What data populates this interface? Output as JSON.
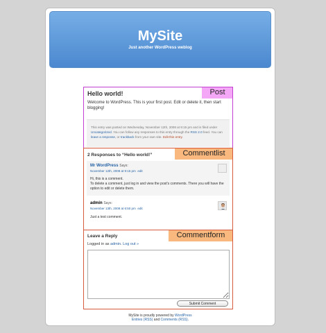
{
  "site": {
    "title": "MySite",
    "description": "Just another WordPress weblog"
  },
  "labels": {
    "post": "Post",
    "commentlist": "Commentlist",
    "commentform": "Commentform"
  },
  "post": {
    "title": "Hello world!",
    "body": "Welcome to WordPress. This is your first post. Edit or delete it, then start blogging!",
    "meta": {
      "part1": "This entry was posted on Wednesday, November 12th, 2008 at 9:15 pm and is filed under ",
      "category": "Uncategorized",
      "part2": ". You can follow any responses to this entry through the ",
      "rss": "RSS 2.0",
      "part3": " feed. You can ",
      "leave_response": "leave a response",
      "part4": ", or ",
      "trackback": "trackback",
      "part5": " from your own site. ",
      "edit": "Edit this entry",
      "part6": "."
    }
  },
  "comments": {
    "title": "2 Responses to “Hello world!”",
    "items": [
      {
        "author": "Mr WordPress",
        "says": "Says:",
        "date": "November 12th, 2008 at 9:15 pm",
        "edit": "edit",
        "line1": "Hi, this is a comment.",
        "line2": "To delete a comment, just log in and view the post's comments. There you will have the option to edit or delete them."
      },
      {
        "author": "admin",
        "says": "Says:",
        "date": "November 13th, 2008 at 6:50 pm",
        "edit": "edit",
        "line1": "Just a test comment."
      }
    ]
  },
  "reply": {
    "title": "Leave a Reply",
    "logged_prefix": "Logged in as ",
    "user": "admin",
    "logged_sep": ". ",
    "logout": "Log out »",
    "textarea_value": "",
    "submit": "Submit Comment"
  },
  "footer": {
    "line1_prefix": "MySite is proudly powered by ",
    "wordpress": "WordPress",
    "entries_rss": "Entries (RSS)",
    "and": " and ",
    "comments_rss": "Comments (RSS)",
    "end": "."
  }
}
